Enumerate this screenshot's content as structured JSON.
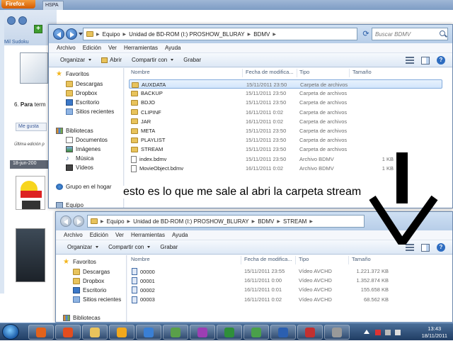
{
  "firefox": {
    "app_button": "Firefox",
    "tab_label": "HSPA",
    "site_logo": "Mil Sudoku",
    "step_number": "6.",
    "step_text_bold": "Para",
    "step_text_rest": " term",
    "like_button": "Me gusta",
    "last_edit": "Última edición p",
    "post_date": "18-jun-200"
  },
  "explorer_top": {
    "breadcrumb": [
      "Equipo",
      "Unidad de BD-ROM (I:) PROSHOW_BLURAY",
      "BDMV"
    ],
    "search_placeholder": "Buscar BDMV",
    "menu": [
      "Archivo",
      "Edición",
      "Ver",
      "Herramientas",
      "Ayuda"
    ],
    "commands": {
      "organize": "Organizar",
      "open": "Abrir",
      "share": "Compartir con",
      "burn": "Grabar"
    },
    "columns": {
      "name": "Nombre",
      "date": "Fecha de modifica...",
      "type": "Tipo",
      "size": "Tamaño"
    },
    "nav": {
      "favorites": "Favoritos",
      "downloads": "Descargas",
      "dropbox": "Dropbox",
      "desktop": "Escritorio",
      "recent": "Sitios recientes",
      "libraries": "Bibliotecas",
      "documents": "Documentos",
      "images": "Imágenes",
      "music": "Música",
      "videos": "Vídeos",
      "homegroup": "Grupo en el hogar",
      "computer": "Equipo"
    },
    "files": [
      {
        "name": "AUXDATA",
        "date": "15/11/2011 23:50",
        "type": "Carpeta de archivos",
        "size": "",
        "kind": "folder",
        "selected": true
      },
      {
        "name": "BACKUP",
        "date": "15/11/2011 23:50",
        "type": "Carpeta de archivos",
        "size": "",
        "kind": "folder",
        "selected": false
      },
      {
        "name": "BDJO",
        "date": "15/11/2011 23:50",
        "type": "Carpeta de archivos",
        "size": "",
        "kind": "folder",
        "selected": false
      },
      {
        "name": "CLIPINF",
        "date": "16/11/2011 0:02",
        "type": "Carpeta de archivos",
        "size": "",
        "kind": "folder",
        "selected": false
      },
      {
        "name": "JAR",
        "date": "16/11/2011 0:02",
        "type": "Carpeta de archivos",
        "size": "",
        "kind": "folder",
        "selected": false
      },
      {
        "name": "META",
        "date": "15/11/2011 23:50",
        "type": "Carpeta de archivos",
        "size": "",
        "kind": "folder",
        "selected": false
      },
      {
        "name": "PLAYLIST",
        "date": "15/11/2011 23:50",
        "type": "Carpeta de archivos",
        "size": "",
        "kind": "folder",
        "selected": false
      },
      {
        "name": "STREAM",
        "date": "15/11/2011 23:50",
        "type": "Carpeta de archivos",
        "size": "",
        "kind": "folder",
        "selected": false
      },
      {
        "name": "index.bdmv",
        "date": "15/11/2011 23:50",
        "type": "Archivo BDMV",
        "size": "1 KB",
        "kind": "file",
        "selected": false
      },
      {
        "name": "MovieObject.bdmv",
        "date": "16/11/2011 0:02",
        "type": "Archivo BDMV",
        "size": "1 KB",
        "kind": "file",
        "selected": false
      }
    ]
  },
  "caption": "esto es lo que me sale al abri la carpeta stream",
  "explorer_bottom": {
    "breadcrumb": [
      "Equipo",
      "Unidad de BD-ROM (I:) PROSHOW_BLURAY",
      "BDMV",
      "STREAM"
    ],
    "menu": [
      "Archivo",
      "Edición",
      "Ver",
      "Herramientas",
      "Ayuda"
    ],
    "commands": {
      "organize": "Organizar",
      "share": "Compartir con",
      "burn": "Grabar"
    },
    "columns": {
      "name": "Nombre",
      "date": "Fecha de modifica...",
      "type": "Tipo",
      "size": "Tamaño"
    },
    "nav": {
      "favorites": "Favoritos",
      "downloads": "Descargas",
      "dropbox": "Dropbox",
      "desktop": "Escritorio",
      "recent": "Sitios recientes",
      "libraries": "Bibliotecas"
    },
    "files": [
      {
        "name": "00000",
        "date": "15/11/2011 23:55",
        "type": "Vídeo AVCHD",
        "size": "1.221.372 KB"
      },
      {
        "name": "00001",
        "date": "16/11/2011 0:00",
        "type": "Vídeo AVCHD",
        "size": "1.352.874 KB"
      },
      {
        "name": "00002",
        "date": "16/11/2011 0:01",
        "type": "Vídeo AVCHD",
        "size": "155.658 KB"
      },
      {
        "name": "00003",
        "date": "16/11/2011 0:02",
        "type": "Vídeo AVCHD",
        "size": "68.562 KB"
      }
    ]
  },
  "taskbar": {
    "clock_time": "13:43",
    "clock_date": "18/11/2011",
    "apps": [
      "firefox-icon",
      "media-player-icon",
      "explorer-icon",
      "pen-icon",
      "app-icon",
      "network-icon",
      "itunes-icon",
      "excel-icon",
      "app2-icon",
      "word-icon",
      "app3-icon",
      "app4-icon"
    ]
  },
  "colors": {
    "selection": "#d2e5fb",
    "taskbar": "#1f3c63",
    "folder": "#e8c35c",
    "accent": "#2c64b1"
  }
}
